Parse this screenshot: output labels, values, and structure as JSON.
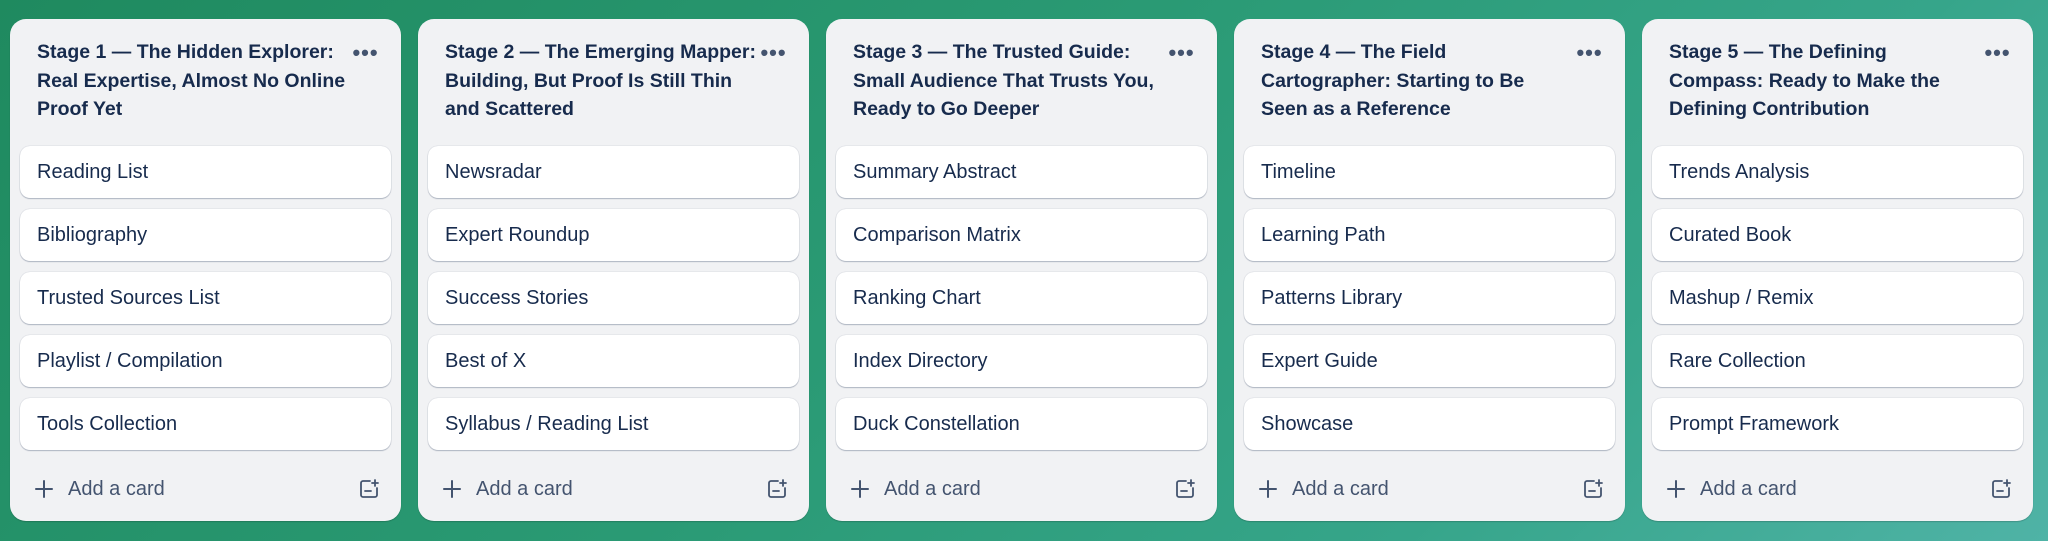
{
  "board": {
    "add_card_label": "Add a card",
    "menu_glyph": "•••",
    "lists": [
      {
        "title": "Stage 1 — The Hidden Explorer: Real Expertise, Almost No Online Proof Yet",
        "cards": [
          "Reading List",
          "Bibliography",
          "Trusted Sources List",
          "Playlist / Compilation",
          "Tools Collection"
        ]
      },
      {
        "title": "Stage 2 — The Emerging Mapper: Building, But Proof Is Still Thin and Scattered",
        "cards": [
          "Newsradar",
          "Expert Roundup",
          "Success Stories",
          "Best of X",
          "Syllabus / Reading List"
        ]
      },
      {
        "title": "Stage 3 — The Trusted Guide: Small Audience That Trusts You, Ready to Go Deeper",
        "cards": [
          "Summary Abstract",
          "Comparison Matrix",
          "Ranking Chart",
          "Index Directory",
          "Duck Constellation"
        ]
      },
      {
        "title": "Stage 4 — The Field Cartographer: Starting to Be Seen as a Reference",
        "cards": [
          "Timeline",
          "Learning Path",
          "Patterns Library",
          "Expert Guide",
          "Showcase"
        ]
      },
      {
        "title": "Stage 5 — The Defining Compass: Ready to Make the Defining Contribution",
        "cards": [
          "Trends Analysis",
          "Curated Book",
          "Mashup / Remix",
          "Rare Collection",
          "Prompt Framework"
        ]
      }
    ]
  },
  "icons": {
    "list_menu": "more-horizontal-icon",
    "add": "plus-icon",
    "template": "create-from-template-icon"
  },
  "colors": {
    "board_background_start": "#1f8a5f",
    "board_background_end": "#4fb3a6",
    "list_background": "#f1f2f4",
    "card_background": "#ffffff",
    "title_text": "#172b4d",
    "muted_text": "#44546f"
  }
}
